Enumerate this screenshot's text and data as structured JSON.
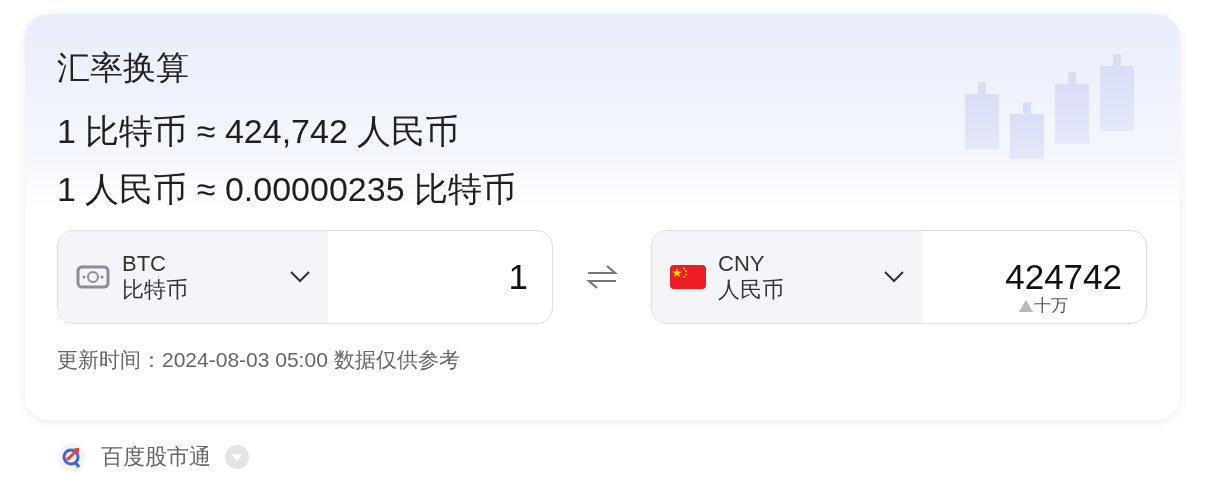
{
  "title": "汇率换算",
  "rates": [
    "1 比特币 ≈ 424,742 人民币",
    "1 人民币 ≈ 0.00000235 比特币"
  ],
  "converters": [
    {
      "kind": "banknote",
      "code": "BTC",
      "name": "比特币",
      "amount": "1"
    },
    {
      "kind": "flag",
      "code": "CNY",
      "name": "人民币",
      "amount": "424742",
      "magnitude": "十万"
    }
  ],
  "updated": "更新时间：2024-08-03 05:00 数据仅供参考",
  "source": {
    "name": "百度股市通"
  }
}
